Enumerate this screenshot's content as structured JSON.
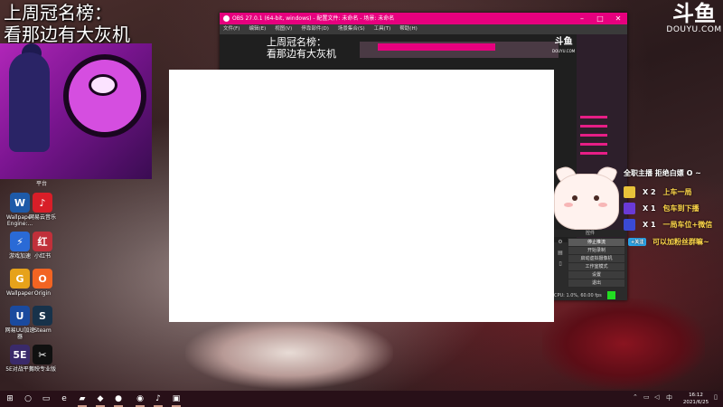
{
  "stream": {
    "title_line1": "上周冠名榜：",
    "title_line2": "看那边有大灰机",
    "art_caption": "平台"
  },
  "platform_logo": {
    "text": "斗鱼",
    "sub": "DOUYU.COM"
  },
  "desktop_icons": [
    {
      "label": "Wallpaper Engine:...",
      "icon": "wallpaper-engine-icon",
      "color": "#1e5aa8",
      "glyph": "W"
    },
    {
      "label": "网易云音乐",
      "icon": "netease-music-icon",
      "color": "#d81e28",
      "glyph": "♪"
    },
    {
      "label": "游戏加速",
      "icon": "game-booster-icon",
      "color": "#2a6ad6",
      "glyph": "⚡"
    },
    {
      "label": "小红书",
      "icon": "app-icon",
      "color": "#c0303a",
      "glyph": "红"
    },
    {
      "label": "Wallpaper",
      "icon": "wallpaper-icon",
      "color": "#e6a21a",
      "glyph": "G"
    },
    {
      "label": "Origin",
      "icon": "origin-icon",
      "color": "#f26422",
      "glyph": "O"
    },
    {
      "label": "网易UU加速器",
      "icon": "uu-booster-icon",
      "color": "#1a4a9e",
      "glyph": "U"
    },
    {
      "label": "Steam",
      "icon": "steam-icon",
      "color": "#17324a",
      "glyph": "S"
    },
    {
      "label": "5E对战平台",
      "icon": "5e-platform-icon",
      "color": "#3a2a6a",
      "glyph": "5E"
    },
    {
      "label": "剪映专业版",
      "icon": "jianying-icon",
      "color": "#101010",
      "glyph": "✂"
    }
  ],
  "obs": {
    "title": "OBS 27.0.1 (64-bit, windows) - 配置文件: 未命名 - 场景: 未命名",
    "menu": [
      "文件(F)",
      "编辑(E)",
      "视图(V)",
      "停靠部件(D)",
      "场景集合(S)",
      "工具(T)",
      "帮助(H)"
    ],
    "nested_title_1": "上周冠名榜：",
    "nested_title_2": "看那边有大灰机",
    "nested_logo": "斗鱼",
    "nested_logo_sub": "DOUYU.COM",
    "controls_header": "控件",
    "controls": [
      "停止推流",
      "开始录制",
      "启动虚拟摄像机",
      "工作室模式",
      "设置",
      "退出"
    ],
    "status": "CPU: 1.0%, 60.00 fps"
  },
  "announcement": "全职主播  拒绝白嫖 O ~",
  "gifts": [
    {
      "mult": "X 2",
      "desc": "上车一局",
      "icon": "gift-yacht-icon",
      "color": "#e8c23a"
    },
    {
      "mult": "X 1",
      "desc": "包车到下播",
      "icon": "gift-rocket-icon",
      "color": "#6a3ad6"
    },
    {
      "mult": "X 1",
      "desc": "一局车位+微信",
      "icon": "gift-plane-icon",
      "color": "#3a4ad6"
    }
  ],
  "follow": {
    "badge": "+关注",
    "text": "可以加粉丝群嘛~"
  },
  "taskbar": {
    "items": [
      {
        "name": "start-button",
        "glyph": "⊞"
      },
      {
        "name": "search-icon",
        "glyph": "○"
      },
      {
        "name": "task-view-icon",
        "glyph": "▭"
      },
      {
        "name": "edge-icon",
        "glyph": "e"
      },
      {
        "name": "file-explorer-icon",
        "glyph": "▰"
      },
      {
        "name": "app-icon",
        "glyph": "◆"
      },
      {
        "name": "steam-icon",
        "glyph": "●"
      },
      {
        "name": "obs-icon",
        "glyph": "◉"
      },
      {
        "name": "netease-music-icon",
        "glyph": "♪"
      },
      {
        "name": "folder-icon",
        "glyph": "▣"
      }
    ],
    "time": "16:12",
    "date": "2021/6/25"
  }
}
